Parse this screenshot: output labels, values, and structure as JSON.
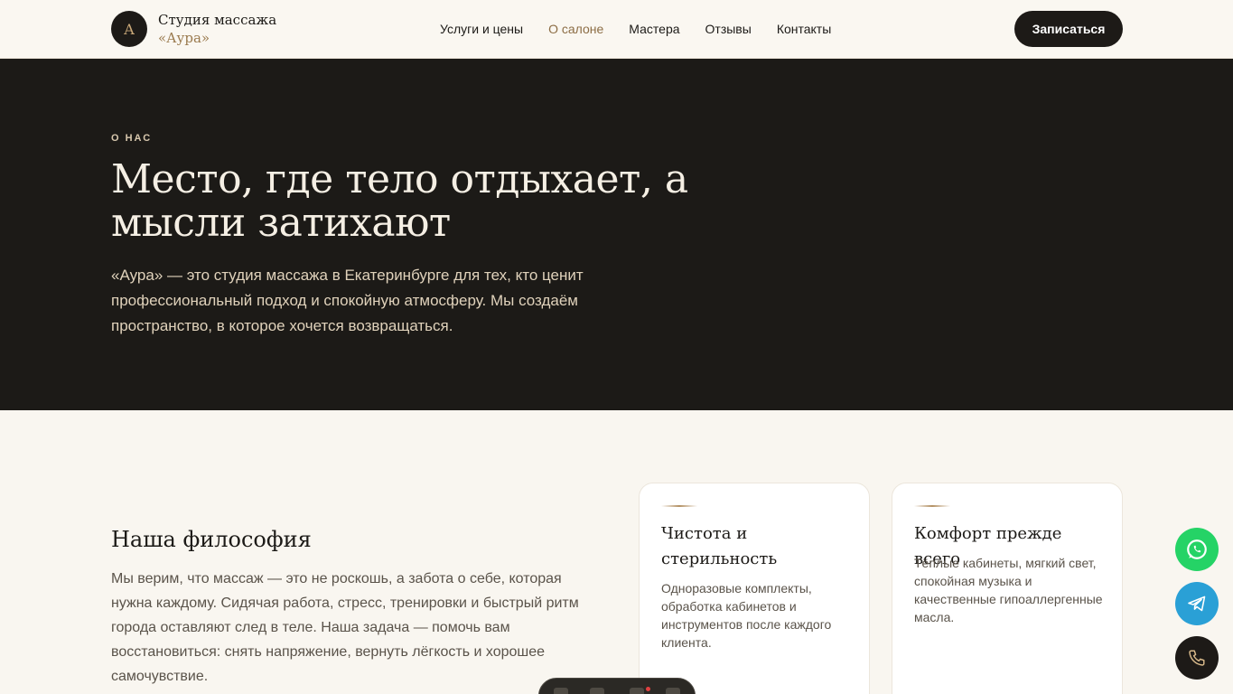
{
  "header": {
    "logo_letter": "A",
    "logo_line1": "Студия массажа",
    "logo_line2": "«Аура»",
    "nav": [
      "Услуги и цены",
      "О салоне",
      "Мастера",
      "Отзывы",
      "Контакты"
    ],
    "active_nav": "О салоне",
    "cta": "Записаться"
  },
  "hero": {
    "eyebrow": "О НАС",
    "title": "Место, где тело отдыхает, а мысли затихают",
    "text": "«Аура» — это студия массажа в Екатеринбурге для тех, кто ценит профессиональный подход и спокойную атмосферу. Мы создаём пространство, в которое хочется возвращаться."
  },
  "philosophy": {
    "title": "Наша философия",
    "text": "Мы верим, что массаж — это не роскошь, а забота о себе, которая нужна каждому. Сидячая работа, стресс, тренировки и быстрый ритм города оставляют след в теле. Наша задача — помочь вам восстановиться: снять напряжение, вернуть лёгкость и хорошее самочувствие."
  },
  "cards": [
    {
      "title": "Чистота и стерильность",
      "text": "Одноразовые комплекты, обработка кабинетов и инструментов после каждого клиента."
    },
    {
      "title": "Комфорт прежде всего",
      "text": "Тёплые кабинеты, мягкий свет, спокойная музыка и качественные гипоаллергенные масла."
    }
  ],
  "floating_buttons": [
    "whatsapp-icon",
    "telegram-icon",
    "phone-icon"
  ],
  "colors": {
    "dark": "#1c1a17",
    "cream": "#f9f6f0",
    "gold": "#9a7a4e",
    "whatsapp": "#25d366",
    "telegram": "#2aa0d6"
  }
}
